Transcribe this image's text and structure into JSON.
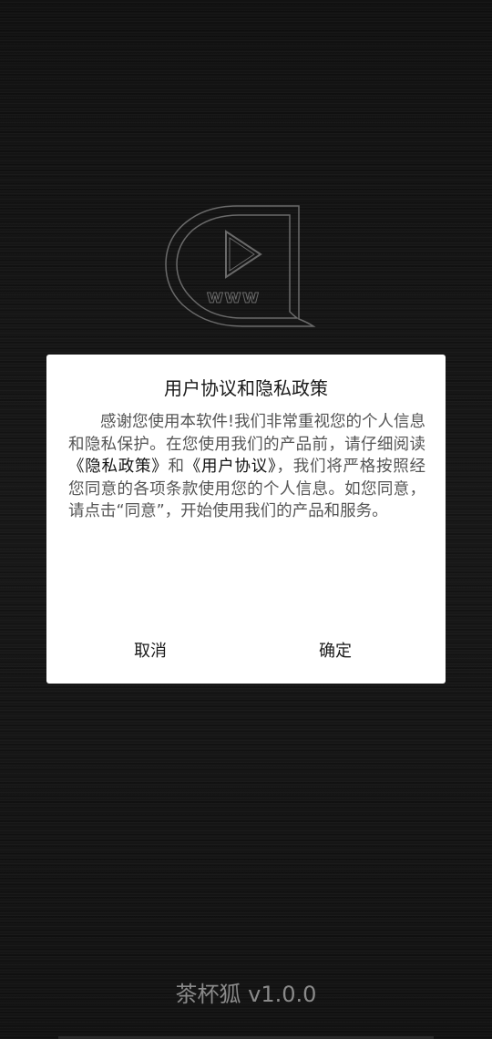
{
  "logo": {
    "text": "www",
    "stroke_color": "#6a6a6a"
  },
  "dialog": {
    "title": "用户协议和隐私政策",
    "body": {
      "part1": "感谢您使用本软件!我们非常重视您的个人信息和隐私保护。在您使用我们的产品前，请仔细阅读",
      "privacy_link": "《隐私政策》",
      "part2": "和",
      "agreement_link": "《用户协议》",
      "part3": "，我们将严格按照经您同意的各项条款使用您的个人信息。如您同意，请点击“同意”，开始使用我们的产品和服务。"
    },
    "cancel_label": "取消",
    "confirm_label": "确定"
  },
  "footer": {
    "app_name_version": "茶杯狐 v1.0.0"
  }
}
